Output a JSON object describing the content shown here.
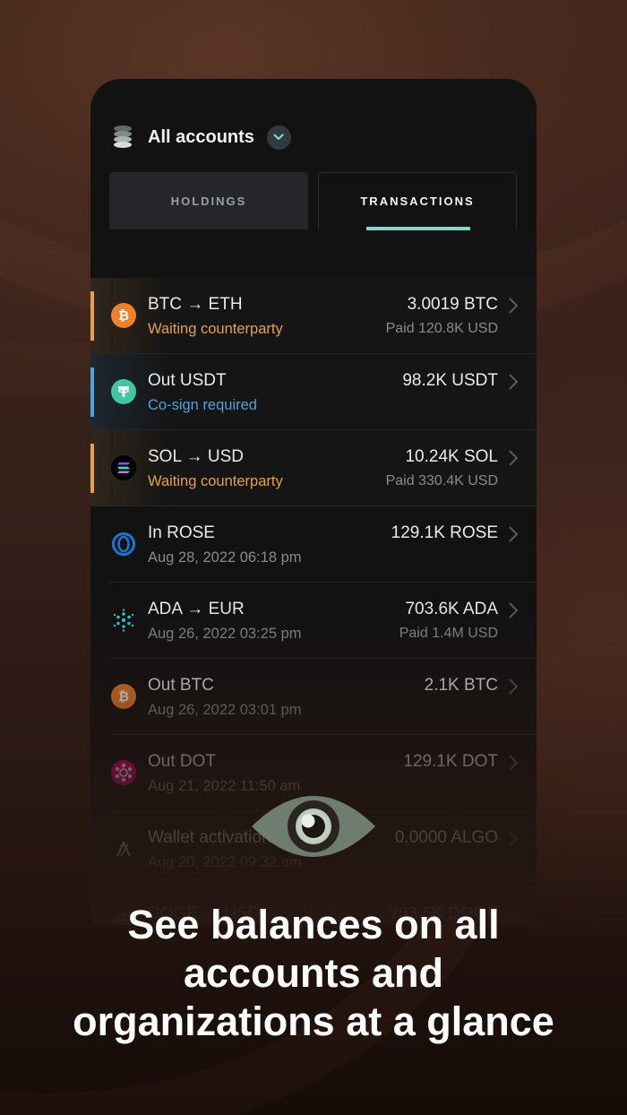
{
  "header": {
    "title": "All accounts",
    "icon": "account-stack-icon"
  },
  "tabs": [
    {
      "label": "HOLDINGS",
      "active": false
    },
    {
      "label": "TRANSACTIONS",
      "active": true
    }
  ],
  "transactions": [
    {
      "title": "BTC → ETH",
      "subtitle": "Waiting counterparty",
      "amount": "3.0019 BTC",
      "paid": "Paid 120.8K USD",
      "icon": "bitcoin-icon"
    },
    {
      "title": "Out USDT",
      "subtitle": "Co-sign required",
      "amount": "98.2K USDT",
      "paid": "",
      "icon": "tether-icon"
    },
    {
      "title": "SOL → USD",
      "subtitle": "Waiting counterparty",
      "amount": "10.24K SOL",
      "paid": "Paid 330.4K USD",
      "icon": "solana-icon"
    },
    {
      "title": "In ROSE",
      "subtitle": "Aug 28, 2022 06:18 pm",
      "amount": "129.1K ROSE",
      "paid": "",
      "icon": "oasis-rose-icon"
    },
    {
      "title": "ADA → EUR",
      "subtitle": "Aug 26, 2022 03:25 pm",
      "amount": "703.6K ADA",
      "paid": "Paid 1.4M USD",
      "icon": "cardano-icon"
    },
    {
      "title": "Out BTC",
      "subtitle": "Aug 26, 2022 03:01 pm",
      "amount": "2.1K BTC",
      "paid": "",
      "icon": "bitcoin-icon"
    },
    {
      "title": "Out DOT",
      "subtitle": "Aug 21, 2022 11:50 am",
      "amount": "129.1K DOT",
      "paid": "",
      "icon": "polkadot-icon"
    },
    {
      "title": "Wallet activation",
      "subtitle": "Aug 20, 2022 09:32 am",
      "amount": "0.0000 ALGO",
      "paid": "",
      "icon": "algorand-icon"
    },
    {
      "title": "DOGE → USD",
      "subtitle": "",
      "amount": "703.6K DOGE",
      "paid": "",
      "icon": "dogecoin-icon"
    }
  ],
  "headline": {
    "line1": "See balances on all",
    "line2": "accounts and",
    "line3": "organizations at a glance"
  },
  "colors": {
    "waiting": "#e6a04a",
    "cosign": "#4fa3dc",
    "tab_underline": "#7fdac8",
    "bitcoin": "#f0812a",
    "tether": "#26a17b"
  }
}
